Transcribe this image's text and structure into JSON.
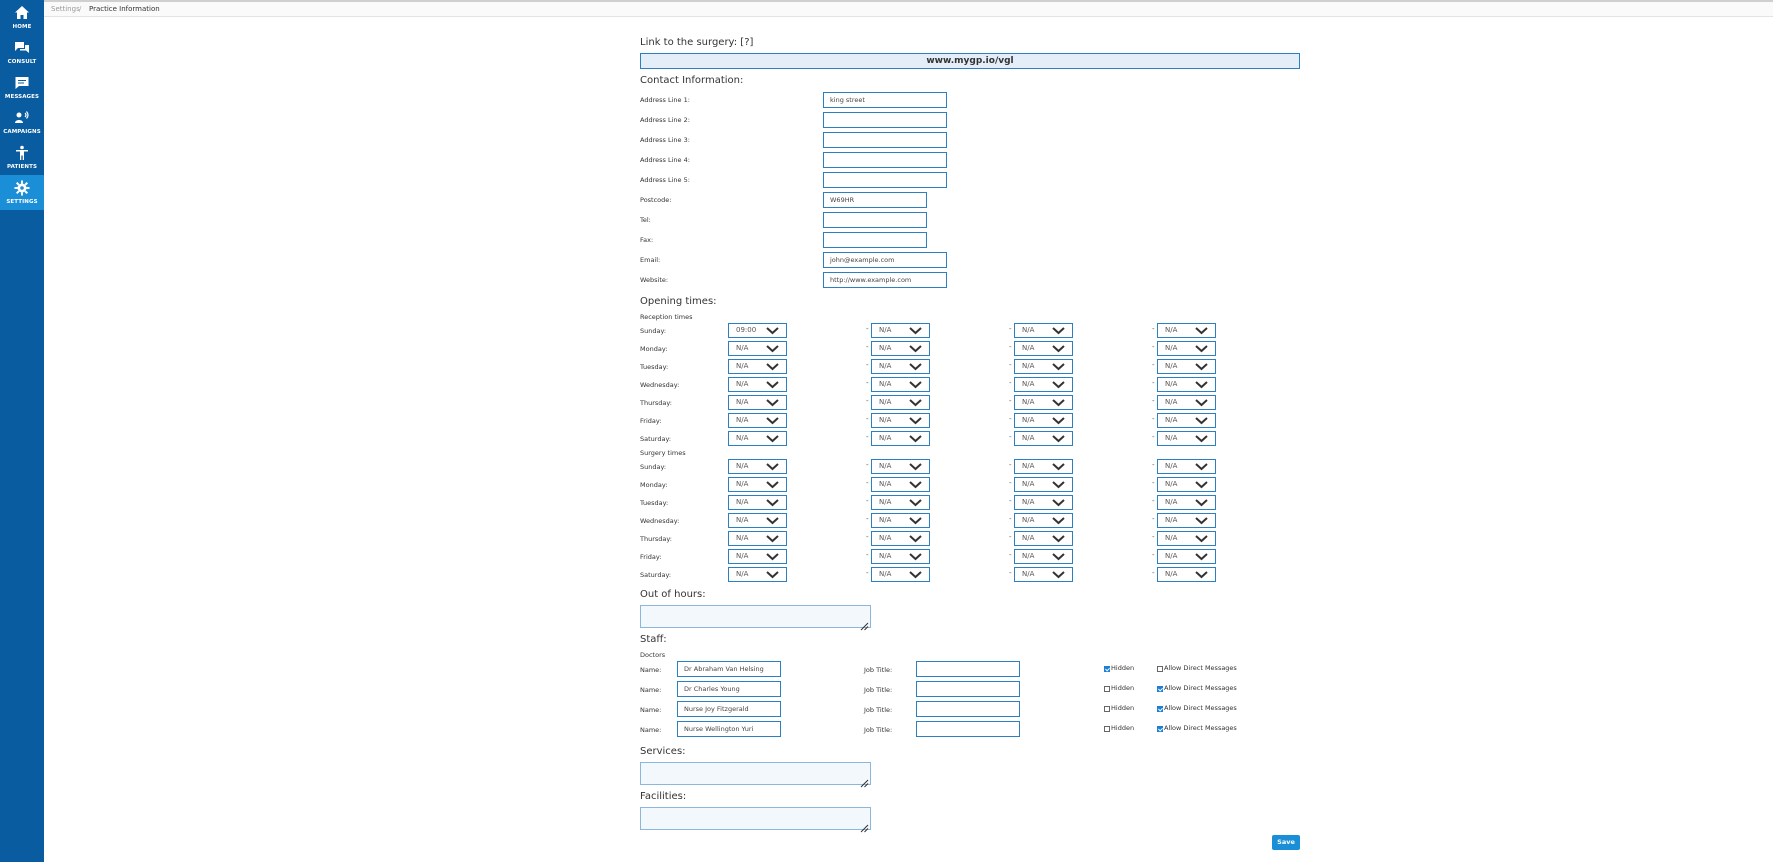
{
  "sidebar": {
    "items": [
      {
        "label": "HOME",
        "icon": "home-icon"
      },
      {
        "label": "CONSULT",
        "icon": "consult-icon"
      },
      {
        "label": "MESSAGES",
        "icon": "messages-icon"
      },
      {
        "label": "CAMPAIGNS",
        "icon": "campaigns-icon"
      },
      {
        "label": "PATIENTS",
        "icon": "patients-icon"
      },
      {
        "label": "SETTINGS",
        "icon": "gear-icon",
        "active": true
      }
    ]
  },
  "breadcrumb": {
    "parent": "Settings",
    "separator": "/",
    "current": "Practice Information"
  },
  "link_section": {
    "heading": "Link to the surgery: [?]",
    "url": "www.mygp.io/vgl"
  },
  "contact": {
    "heading": "Contact Information:",
    "fields": [
      {
        "label": "Address Line 1:",
        "value": "king street"
      },
      {
        "label": "Address Line 2:",
        "value": ""
      },
      {
        "label": "Address Line 3:",
        "value": ""
      },
      {
        "label": "Address Line 4:",
        "value": ""
      },
      {
        "label": "Address Line 5:",
        "value": ""
      },
      {
        "label": "Postcode:",
        "value": "W69HR"
      },
      {
        "label": "Tel:",
        "value": ""
      },
      {
        "label": "Fax:",
        "value": ""
      },
      {
        "label": "Email:",
        "value": "john@example.com"
      },
      {
        "label": "Website:",
        "value": "http://www.example.com"
      }
    ]
  },
  "opening": {
    "heading": "Opening times:",
    "separator": "-",
    "groups": [
      {
        "title": "Reception times",
        "rows": [
          {
            "day": "Sunday:",
            "values": [
              "09:00",
              "N/A",
              "N/A",
              "N/A"
            ]
          },
          {
            "day": "Monday:",
            "values": [
              "N/A",
              "N/A",
              "N/A",
              "N/A"
            ]
          },
          {
            "day": "Tuesday:",
            "values": [
              "N/A",
              "N/A",
              "N/A",
              "N/A"
            ]
          },
          {
            "day": "Wednesday:",
            "values": [
              "N/A",
              "N/A",
              "N/A",
              "N/A"
            ]
          },
          {
            "day": "Thursday:",
            "values": [
              "N/A",
              "N/A",
              "N/A",
              "N/A"
            ]
          },
          {
            "day": "Friday:",
            "values": [
              "N/A",
              "N/A",
              "N/A",
              "N/A"
            ]
          },
          {
            "day": "Saturday:",
            "values": [
              "N/A",
              "N/A",
              "N/A",
              "N/A"
            ]
          }
        ]
      },
      {
        "title": "Surgery times",
        "rows": [
          {
            "day": "Sunday:",
            "values": [
              "N/A",
              "N/A",
              "N/A",
              "N/A"
            ]
          },
          {
            "day": "Monday:",
            "values": [
              "N/A",
              "N/A",
              "N/A",
              "N/A"
            ]
          },
          {
            "day": "Tuesday:",
            "values": [
              "N/A",
              "N/A",
              "N/A",
              "N/A"
            ]
          },
          {
            "day": "Wednesday:",
            "values": [
              "N/A",
              "N/A",
              "N/A",
              "N/A"
            ]
          },
          {
            "day": "Thursday:",
            "values": [
              "N/A",
              "N/A",
              "N/A",
              "N/A"
            ]
          },
          {
            "day": "Friday:",
            "values": [
              "N/A",
              "N/A",
              "N/A",
              "N/A"
            ]
          },
          {
            "day": "Saturday:",
            "values": [
              "N/A",
              "N/A",
              "N/A",
              "N/A"
            ]
          }
        ]
      }
    ]
  },
  "out_of_hours": {
    "heading": "Out of hours:",
    "value": ""
  },
  "staff": {
    "heading": "Staff:",
    "subheading": "Doctors",
    "name_label": "Name:",
    "job_label": "Job Title:",
    "hidden_label": "Hidden",
    "dm_label": "Allow Direct Messages",
    "members": [
      {
        "name": "Dr Abraham Van Helsing",
        "job": "",
        "hidden": true,
        "allow_dm": false
      },
      {
        "name": "Dr Charles Young",
        "job": "",
        "hidden": false,
        "allow_dm": true
      },
      {
        "name": "Nurse Joy Fitzgerald",
        "job": "",
        "hidden": false,
        "allow_dm": true
      },
      {
        "name": "Nurse Wellington Yuri",
        "job": "",
        "hidden": false,
        "allow_dm": true
      }
    ]
  },
  "services": {
    "heading": "Services:",
    "value": ""
  },
  "facilities": {
    "heading": "Facilities:",
    "value": ""
  },
  "save_label": "Save",
  "colors": {
    "sidebar": "#0a5ca0",
    "active": "#1a8fd8",
    "border": "#2c7fc0"
  }
}
